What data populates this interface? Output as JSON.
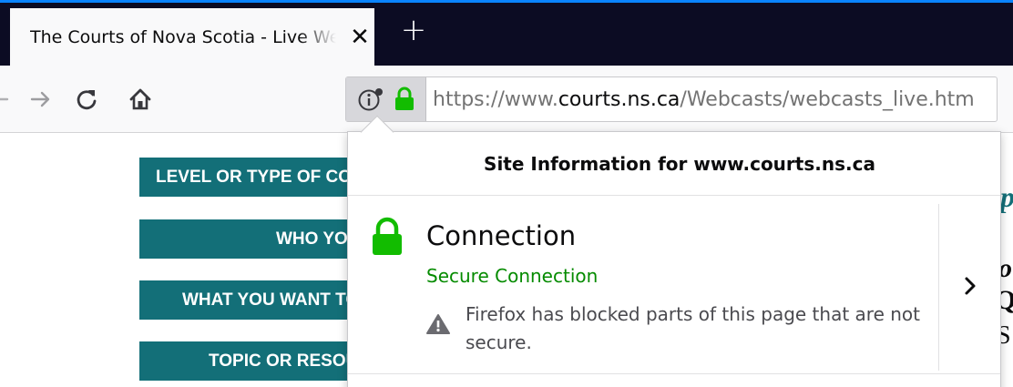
{
  "tab": {
    "title": "The Courts of Nova Scotia - Live Webcasts",
    "close_icon": "close-icon",
    "new_tab_icon": "plus-icon"
  },
  "toolbar": {
    "back_icon": "back-arrow-icon",
    "forward_icon": "forward-arrow-icon",
    "reload_icon": "reload-icon",
    "home_icon": "home-icon",
    "identity_icons": [
      "info-icon",
      "lock-icon"
    ],
    "url": {
      "prefix": "https://www.",
      "domain": "courts.ns.ca",
      "path": "/Webcasts/webcasts_live.htm"
    }
  },
  "page": {
    "buttons": [
      {
        "label": "LEVEL OR TYPE OF COURT"
      },
      {
        "label": "WHO YOU ARE"
      },
      {
        "label": "WHAT YOU WANT TO DO"
      },
      {
        "label": "TOPIC OR RESOURCE"
      }
    ]
  },
  "site_panel": {
    "header": "Site Information for www.courts.ns.ca",
    "connection_title": "Connection",
    "connection_status": "Secure Connection",
    "warning_text": "Firefox has blocked parts of this page that are not secure.",
    "more_icon": "chevron-right-icon"
  },
  "colors": {
    "accent": "#0a84ff",
    "tabstrip": "#0c0c23",
    "secure_green": "#058b00",
    "page_button": "#136f78"
  }
}
